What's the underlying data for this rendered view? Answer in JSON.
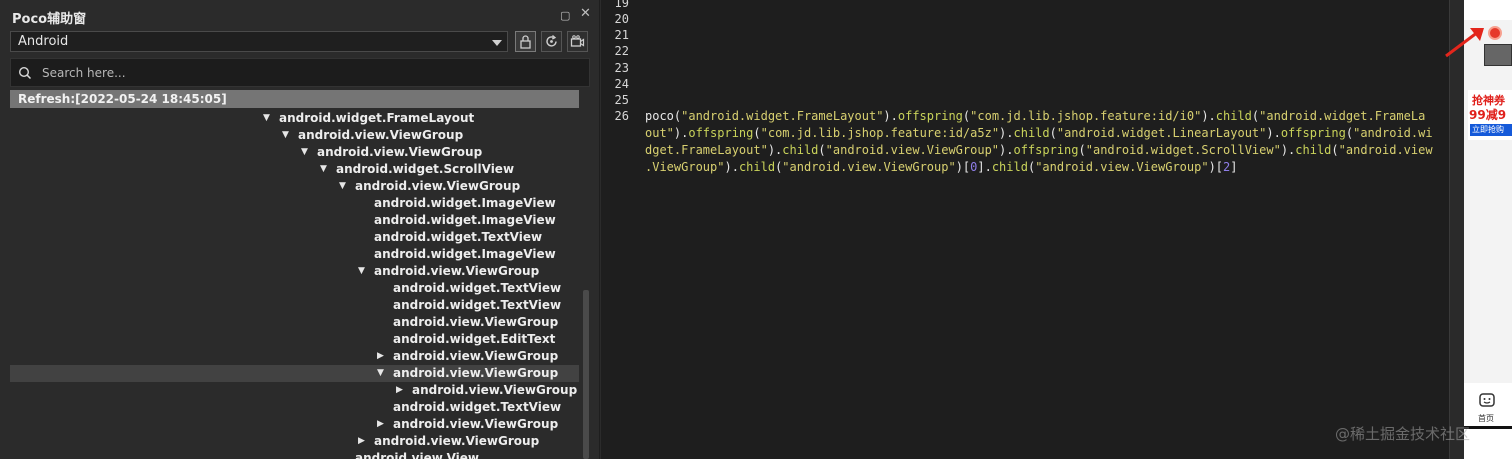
{
  "panel": {
    "title": "Poco辅助窗",
    "platform_value": "Android",
    "search_placeholder": "Search here...",
    "refresh_label": "Refresh:[2022-05-24 18:45:05]"
  },
  "tree": [
    {
      "label": "android.widget.FrameLayout",
      "depth": 0,
      "arrow": "▼"
    },
    {
      "label": "android.view.ViewGroup",
      "depth": 1,
      "arrow": "▼"
    },
    {
      "label": "android.view.ViewGroup",
      "depth": 2,
      "arrow": "▼"
    },
    {
      "label": "android.widget.ScrollView",
      "depth": 3,
      "arrow": "▼"
    },
    {
      "label": "android.view.ViewGroup",
      "depth": 4,
      "arrow": "▼"
    },
    {
      "label": "android.widget.ImageView",
      "depth": 5,
      "arrow": ""
    },
    {
      "label": "android.widget.ImageView",
      "depth": 5,
      "arrow": ""
    },
    {
      "label": "android.widget.TextView",
      "depth": 5,
      "arrow": ""
    },
    {
      "label": "android.widget.ImageView",
      "depth": 5,
      "arrow": ""
    },
    {
      "label": "android.view.ViewGroup",
      "depth": 5,
      "arrow": "▼"
    },
    {
      "label": "android.widget.TextView",
      "depth": 6,
      "arrow": ""
    },
    {
      "label": "android.widget.TextView",
      "depth": 6,
      "arrow": ""
    },
    {
      "label": "android.view.ViewGroup",
      "depth": 6,
      "arrow": ""
    },
    {
      "label": "android.widget.EditText",
      "depth": 6,
      "arrow": ""
    },
    {
      "label": "android.view.ViewGroup",
      "depth": 6,
      "arrow": "▶"
    },
    {
      "label": "android.view.ViewGroup",
      "depth": 6,
      "arrow": "▼",
      "selected": true
    },
    {
      "label": "android.view.ViewGroup",
      "depth": 7,
      "arrow": "▶"
    },
    {
      "label": "android.widget.TextView",
      "depth": 6,
      "arrow": ""
    },
    {
      "label": "android.view.ViewGroup",
      "depth": 6,
      "arrow": "▶"
    },
    {
      "label": "android.view.ViewGroup",
      "depth": 5,
      "arrow": "▶"
    },
    {
      "label": "android.view.View",
      "depth": 4,
      "arrow": ""
    }
  ],
  "editor": {
    "line_numbers": [
      "19",
      "20",
      "21",
      "22",
      "23",
      "24",
      "25",
      "26"
    ],
    "code_lines": [
      [
        {
          "t": "poco(",
          "c": "default"
        },
        {
          "t": "\"android.widget.FrameLayout\"",
          "c": "string"
        },
        {
          "t": ").",
          "c": "default"
        },
        {
          "t": "offspring",
          "c": "method"
        },
        {
          "t": "(",
          "c": "default"
        },
        {
          "t": "\"com.jd.lib.jshop.feature:id/i0\"",
          "c": "string"
        },
        {
          "t": ").",
          "c": "default"
        },
        {
          "t": "child",
          "c": "method"
        },
        {
          "t": "(",
          "c": "default"
        },
        {
          "t": "\"android.widget.FrameLa",
          "c": "string"
        }
      ],
      [
        {
          "t": "out\"",
          "c": "string"
        },
        {
          "t": ").",
          "c": "default"
        },
        {
          "t": "offspring",
          "c": "method"
        },
        {
          "t": "(",
          "c": "default"
        },
        {
          "t": "\"com.jd.lib.jshop.feature:id/a5z\"",
          "c": "string"
        },
        {
          "t": ").",
          "c": "default"
        },
        {
          "t": "child",
          "c": "method"
        },
        {
          "t": "(",
          "c": "default"
        },
        {
          "t": "\"android.widget.LinearLayout\"",
          "c": "string"
        },
        {
          "t": ").",
          "c": "default"
        },
        {
          "t": "offspring",
          "c": "method"
        },
        {
          "t": "(",
          "c": "default"
        },
        {
          "t": "\"android.wi",
          "c": "string"
        }
      ],
      [
        {
          "t": "dget.FrameLayout\"",
          "c": "string"
        },
        {
          "t": ").",
          "c": "default"
        },
        {
          "t": "child",
          "c": "method"
        },
        {
          "t": "(",
          "c": "default"
        },
        {
          "t": "\"android.view.ViewGroup\"",
          "c": "string"
        },
        {
          "t": ").",
          "c": "default"
        },
        {
          "t": "offspring",
          "c": "method"
        },
        {
          "t": "(",
          "c": "default"
        },
        {
          "t": "\"android.widget.ScrollView\"",
          "c": "string"
        },
        {
          "t": ").",
          "c": "default"
        },
        {
          "t": "child",
          "c": "method"
        },
        {
          "t": "(",
          "c": "default"
        },
        {
          "t": "\"android.view",
          "c": "string"
        }
      ],
      [
        {
          "t": ".ViewGroup\"",
          "c": "string"
        },
        {
          "t": ").",
          "c": "default"
        },
        {
          "t": "child",
          "c": "method"
        },
        {
          "t": "(",
          "c": "default"
        },
        {
          "t": "\"android.view.ViewGroup\"",
          "c": "string"
        },
        {
          "t": ")[",
          "c": "default"
        },
        {
          "t": "0",
          "c": "number"
        },
        {
          "t": "].",
          "c": "default"
        },
        {
          "t": "child",
          "c": "method"
        },
        {
          "t": "(",
          "c": "default"
        },
        {
          "t": "\"android.view.ViewGroup\"",
          "c": "string"
        },
        {
          "t": ")[",
          "c": "default"
        },
        {
          "t": "2",
          "c": "number"
        },
        {
          "t": "]",
          "c": "default"
        }
      ]
    ]
  },
  "phone": {
    "promo_line1": "抢神券",
    "promo_line2": "99减9",
    "promo_button": "立即抢购",
    "home_label": "首页"
  },
  "watermark": "@稀土掘金技术社区",
  "colors": {
    "panel_bg": "#2b2b2b",
    "editor_bg": "#1e1e1e",
    "selected_row": "#424242",
    "refresh_bar": "#757575",
    "method": "#c9d35a",
    "string": "#d8d070",
    "number": "#8f7ee8",
    "promo_red": "#e0201b",
    "promo_blue": "#1459d9"
  }
}
